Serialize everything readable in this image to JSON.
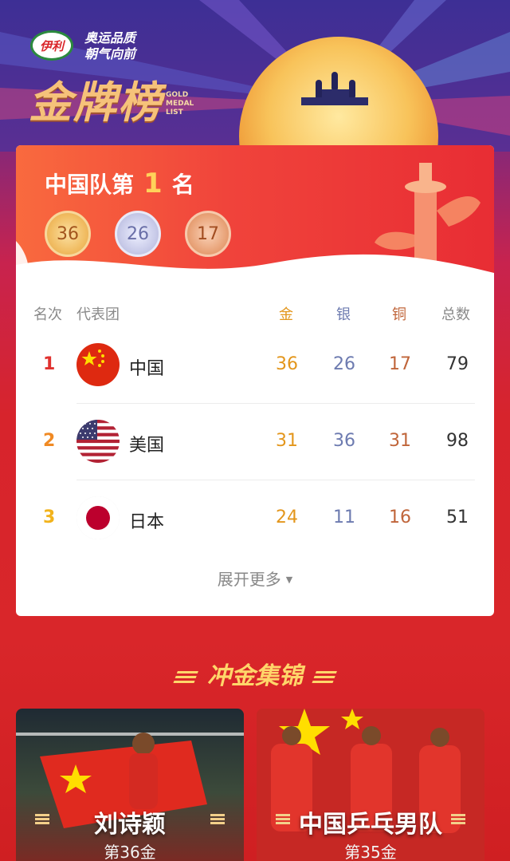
{
  "header": {
    "logo_text": "伊利",
    "slogan_line1": "奥运品质",
    "slogan_line2": "朝气向前",
    "title": "金牌榜",
    "title_en_1": "GOLD",
    "title_en_2": "MEDAL",
    "title_en_3": "LIST"
  },
  "summary": {
    "prefix": "中国队第",
    "rank": "1",
    "suffix": "名",
    "gold": "36",
    "silver": "26",
    "bronze": "17"
  },
  "table": {
    "headers": {
      "rank": "名次",
      "team": "代表团",
      "gold": "金",
      "silver": "银",
      "bronze": "铜",
      "total": "总数"
    },
    "rows": [
      {
        "rank": "1",
        "name": "中国",
        "flag": "china-flag-icon",
        "gold": "36",
        "silver": "26",
        "bronze": "17",
        "total": "79",
        "rank_color": "#e0322f"
      },
      {
        "rank": "2",
        "name": "美国",
        "flag": "usa-flag-icon",
        "gold": "31",
        "silver": "36",
        "bronze": "31",
        "total": "98",
        "rank_color": "#f08a24"
      },
      {
        "rank": "3",
        "name": "日本",
        "flag": "japan-flag-icon",
        "gold": "24",
        "silver": "11",
        "bronze": "16",
        "total": "51",
        "rank_color": "#f2b31c"
      }
    ],
    "expand_label": "展开更多"
  },
  "highlights": {
    "title": "冲金集锦",
    "items": [
      {
        "name": "刘诗颖",
        "subtitle": "第36金"
      },
      {
        "name": "中国乒乓男队",
        "subtitle": "第35金"
      }
    ]
  },
  "colors": {
    "gold": "#e3961c",
    "silver": "#6d7bb0",
    "bronze": "#c0653a",
    "accent_red": "#e0322f"
  }
}
